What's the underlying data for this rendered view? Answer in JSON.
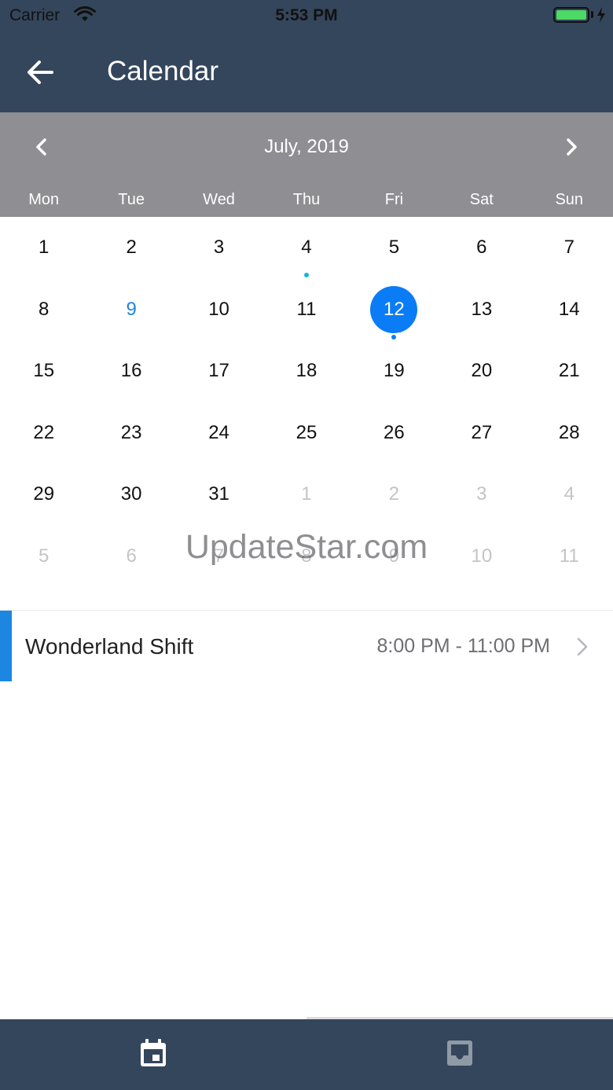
{
  "status_bar": {
    "carrier": "Carrier",
    "time": "5:53 PM"
  },
  "header": {
    "title": "Calendar"
  },
  "calendar": {
    "month_label": "July, 2019",
    "weekdays": [
      "Mon",
      "Tue",
      "Wed",
      "Thu",
      "Fri",
      "Sat",
      "Sun"
    ],
    "weeks": [
      [
        {
          "d": "1"
        },
        {
          "d": "2"
        },
        {
          "d": "3"
        },
        {
          "d": "4",
          "dot": "#14b8d6"
        },
        {
          "d": "5"
        },
        {
          "d": "6"
        },
        {
          "d": "7"
        }
      ],
      [
        {
          "d": "8"
        },
        {
          "d": "9",
          "today": true
        },
        {
          "d": "10"
        },
        {
          "d": "11"
        },
        {
          "d": "12",
          "selected": true,
          "dot": "#0a7cf5"
        },
        {
          "d": "13"
        },
        {
          "d": "14"
        }
      ],
      [
        {
          "d": "15"
        },
        {
          "d": "16"
        },
        {
          "d": "17"
        },
        {
          "d": "18"
        },
        {
          "d": "19"
        },
        {
          "d": "20"
        },
        {
          "d": "21"
        }
      ],
      [
        {
          "d": "22"
        },
        {
          "d": "23"
        },
        {
          "d": "24"
        },
        {
          "d": "25"
        },
        {
          "d": "26"
        },
        {
          "d": "27"
        },
        {
          "d": "28"
        }
      ],
      [
        {
          "d": "29"
        },
        {
          "d": "30"
        },
        {
          "d": "31"
        },
        {
          "d": "1",
          "other": true
        },
        {
          "d": "2",
          "other": true
        },
        {
          "d": "3",
          "other": true
        },
        {
          "d": "4",
          "other": true
        }
      ],
      [
        {
          "d": "5",
          "other": true
        },
        {
          "d": "6",
          "other": true
        },
        {
          "d": "7",
          "other": true
        },
        {
          "d": "8",
          "other": true
        },
        {
          "d": "9",
          "other": true
        },
        {
          "d": "10",
          "other": true
        },
        {
          "d": "11",
          "other": true
        }
      ]
    ]
  },
  "event": {
    "title": "Wonderland Shift",
    "time": "8:00 PM - 11:00 PM",
    "accent_color": "#1c86e0"
  },
  "watermark": "UpdateStar.com",
  "tabs": [
    {
      "icon": "calendar-icon",
      "active": true
    },
    {
      "icon": "inbox-icon",
      "active": false
    }
  ],
  "colors": {
    "header_bg": "#34465b",
    "month_bar_bg": "#8e8e93",
    "selected_day": "#0a7cf5",
    "today_text": "#1c86e0"
  }
}
